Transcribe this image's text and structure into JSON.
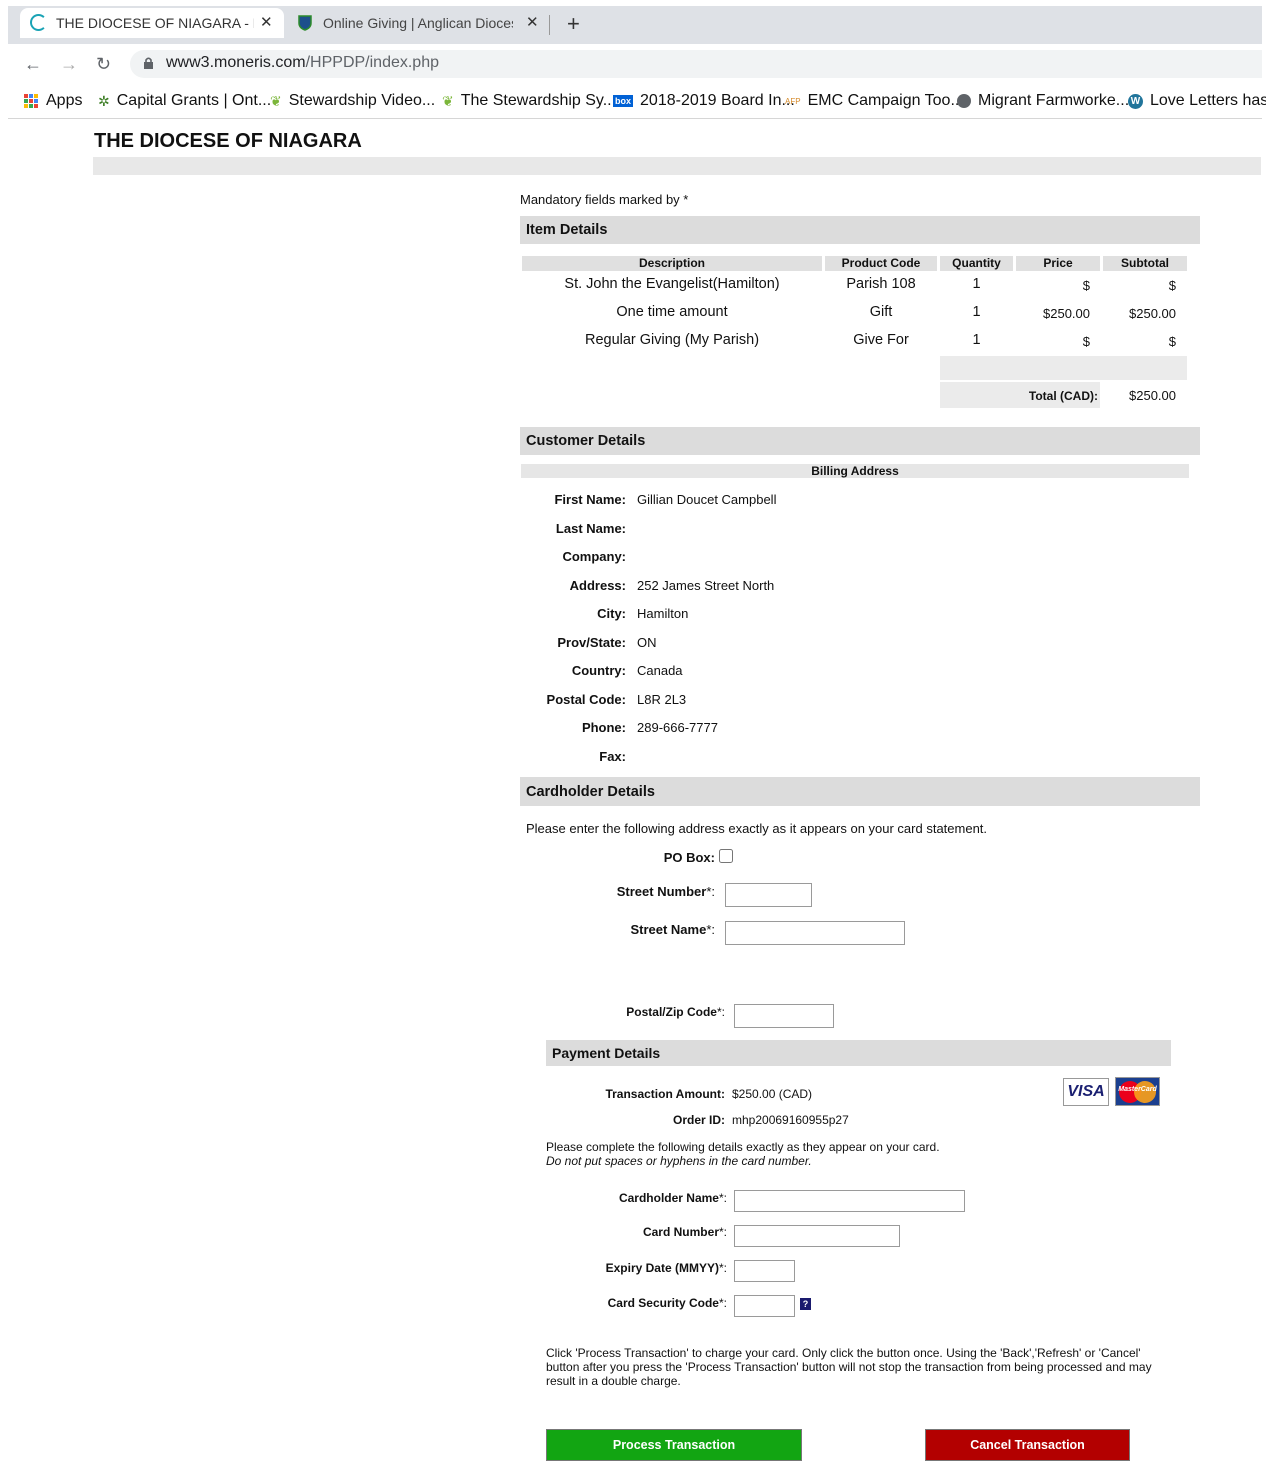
{
  "browser": {
    "tabs": [
      {
        "title": "THE DIOCESE OF NIAGARA - Mon",
        "active": true
      },
      {
        "title": "Online Giving | Anglican Diocese",
        "active": false
      }
    ],
    "new_tab": "+",
    "url_host": "www3.moneris.com",
    "url_path": "/HPPDP/index.php",
    "bookmarks": [
      {
        "label": "Apps",
        "icon": "apps-grid-icon"
      },
      {
        "label": "Capital Grants | Ont...",
        "icon": "trillium-icon"
      },
      {
        "label": "Stewardship Video...",
        "icon": "leaf-icon"
      },
      {
        "label": "The Stewardship Sy...",
        "icon": "leaf-icon"
      },
      {
        "label": "2018-2019 Board In...",
        "icon": "box-icon",
        "badge": "box"
      },
      {
        "label": "EMC Campaign Too...",
        "icon": "afp-icon",
        "badge": "AFP"
      },
      {
        "label": "Migrant Farmworke...",
        "icon": "globe-icon"
      },
      {
        "label": "Love Letters has a",
        "icon": "wordpress-icon"
      }
    ]
  },
  "site": {
    "title": "THE DIOCESE OF NIAGARA"
  },
  "mandatory_note": "Mandatory fields marked by *",
  "item_details": {
    "heading": "Item Details",
    "columns": [
      "Description",
      "Product Code",
      "Quantity",
      "Price",
      "Subtotal"
    ],
    "rows": [
      {
        "description": "St. John the Evangelist(Hamilton)",
        "code": "Parish 108",
        "qty": "1",
        "price": "$",
        "subtotal": "$"
      },
      {
        "description": "One time amount",
        "code": "Gift",
        "qty": "1",
        "price": "$250.00",
        "subtotal": "$250.00"
      },
      {
        "description": "Regular Giving (My Parish)",
        "code": "Give For",
        "qty": "1",
        "price": "$",
        "subtotal": "$"
      }
    ],
    "total_label": "Total (CAD):",
    "total_value": "$250.00"
  },
  "customer_details": {
    "heading": "Customer Details",
    "subheading": "Billing Address",
    "fields": [
      {
        "label": "First Name:",
        "value": "Gillian Doucet Campbell"
      },
      {
        "label": "Last Name:",
        "value": ""
      },
      {
        "label": "Company:",
        "value": ""
      },
      {
        "label": "Address:",
        "value": "252 James Street North"
      },
      {
        "label": "City:",
        "value": "Hamilton"
      },
      {
        "label": "Prov/State:",
        "value": "ON"
      },
      {
        "label": "Country:",
        "value": "Canada"
      },
      {
        "label": "Postal Code:",
        "value": "L8R 2L3"
      },
      {
        "label": "Phone:",
        "value": "289-666-7777"
      },
      {
        "label": "Fax:",
        "value": ""
      }
    ]
  },
  "cardholder_details": {
    "heading": "Cardholder Details",
    "instruction": "Please enter the following address exactly as it appears on your card statement.",
    "po_box_label": "PO Box:",
    "street_number_label": "Street Number",
    "street_name_label": "Street Name",
    "postal_label": "Postal/Zip Code",
    "required_mark": "*:",
    "street_number_value": "",
    "street_name_value": "",
    "postal_value": ""
  },
  "payment_details": {
    "heading": "Payment Details",
    "amount_label": "Transaction Amount:",
    "amount_value": "$250.00 (CAD)",
    "order_label": "Order ID:",
    "order_value": "mhp20069160955p27",
    "cards": {
      "visa": "VISA",
      "mastercard": "MasterCard"
    },
    "instruction_line1": "Please complete the following details exactly as they appear on your card.",
    "instruction_line2": "Do not put spaces or hyphens in the card number.",
    "cardholder_name_label": "Cardholder Name",
    "card_number_label": "Card Number",
    "expiry_label": "Expiry Date (MMYY)",
    "cvv_label": "Card Security Code",
    "cvv_help": "?",
    "required_mark": "*:",
    "notice": "Click 'Process Transaction' to charge your card. Only click the button once. Using the 'Back','Refresh' or 'Cancel' button after you press the 'Process Transaction' button will not stop the transaction from being processed and may result in a double charge.",
    "process_label": "Process Transaction",
    "cancel_label": "Cancel Transaction"
  },
  "colors": {
    "process": "#12a512",
    "cancel": "#b30000",
    "section_bg": "#dcdcdc"
  }
}
